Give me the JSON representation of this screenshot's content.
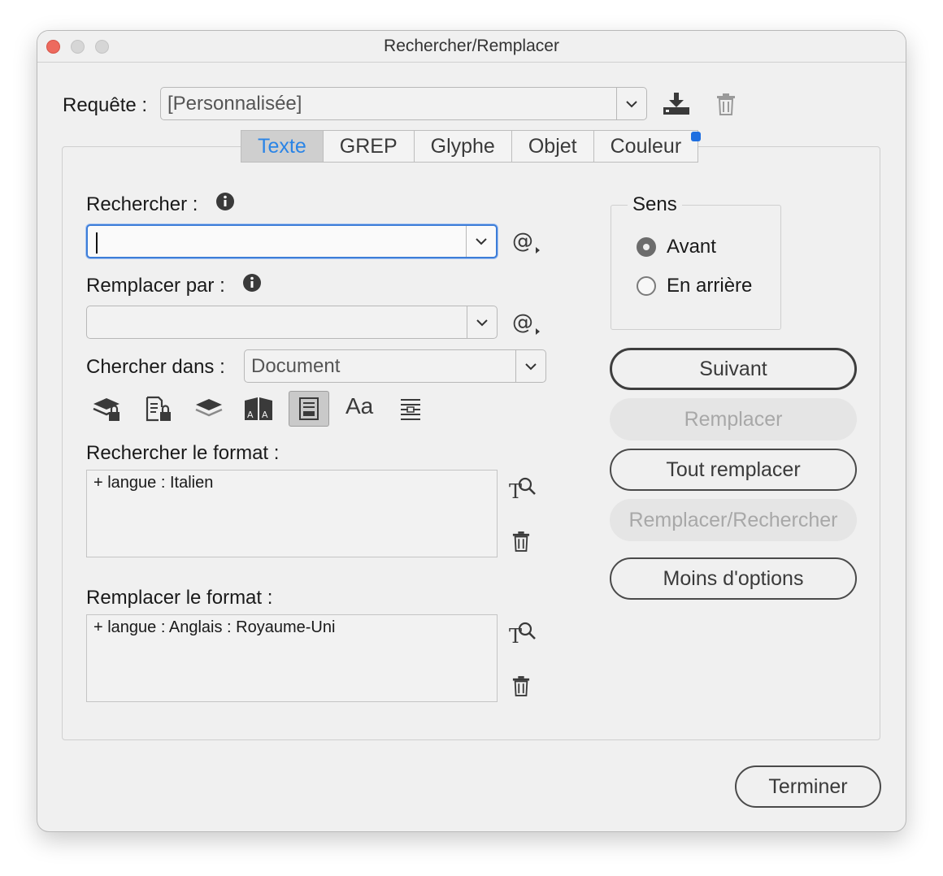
{
  "window": {
    "title": "Rechercher/Remplacer"
  },
  "query": {
    "label": "Requête :",
    "value": "[Personnalisée]"
  },
  "icons": {
    "save_query": "download-icon",
    "delete_query": "trash-icon",
    "info": "info-icon",
    "special_chars": "at-menu-icon",
    "format_search": "text-format-magnifier-icon",
    "format_clear": "trash-icon"
  },
  "tabs": [
    {
      "label": "Texte",
      "active": true
    },
    {
      "label": "GREP",
      "active": false
    },
    {
      "label": "Glyphe",
      "active": false
    },
    {
      "label": "Objet",
      "active": false
    },
    {
      "label": "Couleur",
      "active": false
    }
  ],
  "search": {
    "label": "Rechercher :",
    "value": ""
  },
  "replace": {
    "label": "Remplacer par :",
    "value": ""
  },
  "scope": {
    "label": "Chercher dans :",
    "value": "Document"
  },
  "options_toolbar": {
    "aa_label": "Aa",
    "items": [
      "locked-layers-icon",
      "locked-stories-icon",
      "hidden-layers-icon",
      "master-pages-icon",
      "footnotes-icon",
      "case-sensitive-icon",
      "whole-word-icon"
    ]
  },
  "find_format": {
    "label": "Rechercher le format :",
    "value": "+ langue : Italien"
  },
  "change_format": {
    "label": "Remplacer le format :",
    "value": "+ langue : Anglais : Royaume-Uni"
  },
  "direction": {
    "title": "Sens",
    "options": [
      {
        "label": "Avant",
        "selected": true
      },
      {
        "label": "En arrière",
        "selected": false
      }
    ]
  },
  "buttons": {
    "next": "Suivant",
    "replace": "Remplacer",
    "replace_all": "Tout remplacer",
    "replace_find": "Remplacer/Rechercher",
    "fewer_options": "Moins d'options",
    "done": "Terminer"
  },
  "colors": {
    "accent": "#2a84e6",
    "badge": "#1f6fe0",
    "close": "#ed6a5e"
  }
}
